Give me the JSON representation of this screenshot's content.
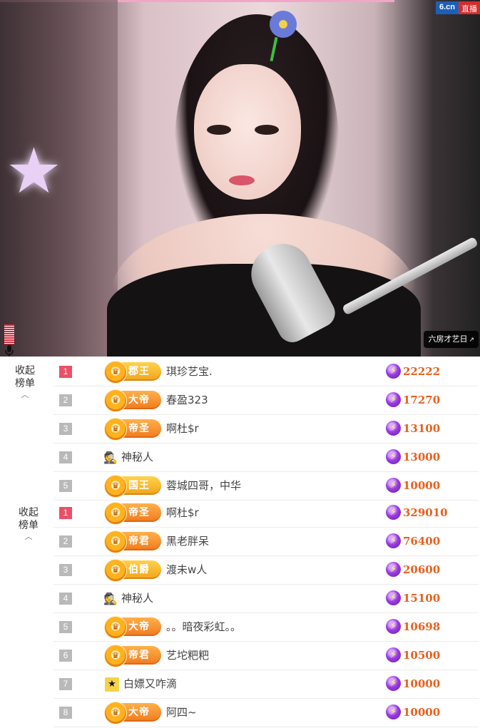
{
  "stream": {
    "logo_site": "6.cn",
    "logo_live": "直播",
    "room_tag": "六房才艺日",
    "room_tag_icon": "external-link-icon"
  },
  "ranking": {
    "collapse_label_line1": "收起",
    "collapse_label_line2": "榜单",
    "panels": [
      {
        "rows": [
          {
            "rank": "1",
            "badge": "郡王",
            "badge_style": "gold",
            "name": "琪珍艺宝.",
            "score": "22222"
          },
          {
            "rank": "2",
            "badge": "大帝",
            "badge_style": "orange",
            "name": "春盈323",
            "score": "17270"
          },
          {
            "rank": "3",
            "badge": "帝圣",
            "badge_style": "orange",
            "name": "啊杜$r",
            "score": "13100"
          },
          {
            "rank": "4",
            "badge": "",
            "badge_style": "mystery",
            "name": "神秘人",
            "score": "13000"
          },
          {
            "rank": "5",
            "badge": "国王",
            "badge_style": "gold",
            "name": "蓉城四哥，中华",
            "score": "10000"
          }
        ]
      },
      {
        "rows": [
          {
            "rank": "1",
            "badge": "帝圣",
            "badge_style": "orange",
            "name": "啊杜$r",
            "score": "329010"
          },
          {
            "rank": "2",
            "badge": "帝君",
            "badge_style": "orange",
            "name": "黑老胖呆",
            "score": "76400"
          },
          {
            "rank": "3",
            "badge": "伯爵",
            "badge_style": "gold",
            "name": "渡未w人",
            "score": "20600"
          },
          {
            "rank": "4",
            "badge": "",
            "badge_style": "mystery",
            "name": "神秘人",
            "score": "15100"
          },
          {
            "rank": "5",
            "badge": "大帝",
            "badge_style": "orange",
            "name": "。。暗夜彩虹。。",
            "score": "10698"
          },
          {
            "rank": "6",
            "badge": "帝君",
            "badge_style": "orange",
            "name": "艺坨粑粑",
            "score": "10500"
          },
          {
            "rank": "7",
            "badge": "",
            "badge_style": "small",
            "name": "白嫖又咋滴",
            "score": "10000"
          },
          {
            "rank": "8",
            "badge": "大帝",
            "badge_style": "orange",
            "name": "阿四~",
            "score": "10000"
          }
        ]
      }
    ]
  },
  "colors": {
    "rank_top": "#ec4f66",
    "rank_other": "#b9b9b9",
    "score": "#e8601e",
    "badge_orange": "#f07a1e",
    "badge_gold": "#f1a51b"
  }
}
